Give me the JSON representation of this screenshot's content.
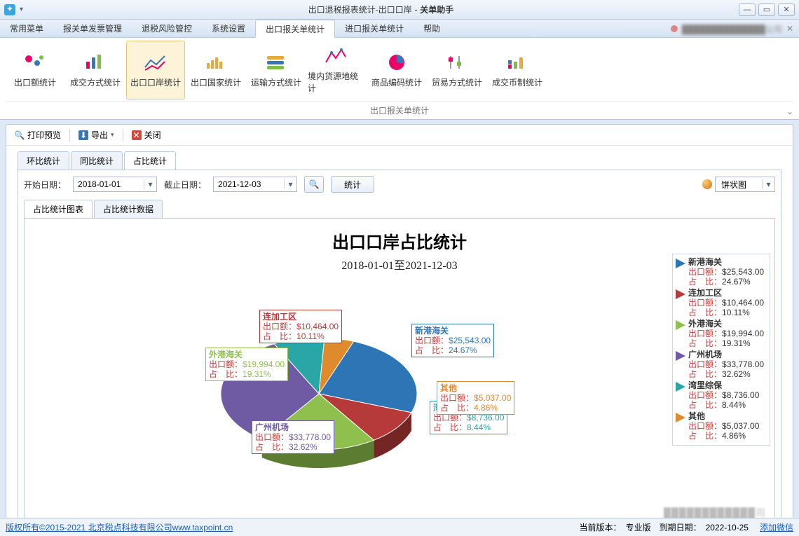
{
  "window": {
    "title_prefix": "出口退税报表统计-出口口岸",
    "title_app": "关单助手",
    "company_text": "██████████████公司"
  },
  "menus": [
    "常用菜单",
    "报关单发票管理",
    "退税风险管控",
    "系统设置",
    "出口报关单统计",
    "进口报关单统计",
    "帮助"
  ],
  "active_menu_index": 4,
  "ribbon": {
    "caption": "出口报关单统计",
    "items": [
      "出口额统计",
      "成交方式统计",
      "出口口岸统计",
      "出口国家统计",
      "运输方式统计",
      "境内货源地统计",
      "商品编码统计",
      "贸易方式统计",
      "成交币制统计"
    ],
    "active_index": 2
  },
  "toolbar": {
    "print_preview": "打印预览",
    "export": "导出",
    "close": "关闭"
  },
  "subtabs": [
    "环比统计",
    "同比统计",
    "占比统计"
  ],
  "active_subtab": 2,
  "filters": {
    "start_label": "开始日期：",
    "start_value": "2018-01-01",
    "end_label": "截止日期：",
    "end_value": "2021-12-03",
    "stat_btn": "统计",
    "chart_type": "饼状图"
  },
  "innertabs": [
    "占比统计图表",
    "占比统计数据"
  ],
  "active_innertab": 0,
  "chart": {
    "title": "出口口岸占比统计",
    "subtitle": "2018-01-01至2021-12-03",
    "amount_label": "出口额：",
    "ratio_label": "占　比："
  },
  "chart_data": {
    "type": "pie",
    "title": "出口口岸占比统计",
    "subtitle": "2018-01-01至2021-12-03",
    "series": [
      {
        "name": "新港海关",
        "amount": "$25,543.00",
        "percent": 24.67,
        "color": "#2e75b6"
      },
      {
        "name": "连加工区",
        "amount": "$10,464.00",
        "percent": 10.11,
        "color": "#b73a3a"
      },
      {
        "name": "外港海关",
        "amount": "$19,994.00",
        "percent": 19.31,
        "color": "#8fbf4d"
      },
      {
        "name": "广州机场",
        "amount": "$33,778.00",
        "percent": 32.62,
        "color": "#6f5ba3"
      },
      {
        "name": "湾里综保",
        "amount": "$8,736.00",
        "percent": 8.44,
        "color": "#2aa6a6"
      },
      {
        "name": "其他",
        "amount": "$5,037.00",
        "percent": 4.86,
        "color": "#e08a2e"
      }
    ]
  },
  "status": {
    "copyright": "版权所有©2015-2021 北京税点科技有限公司www.taxpoint.cn",
    "version_label": "当前版本：",
    "version": "专业版",
    "expire_label": "到期日期：",
    "expire": "2022-10-25",
    "wechat": "添加微信"
  }
}
